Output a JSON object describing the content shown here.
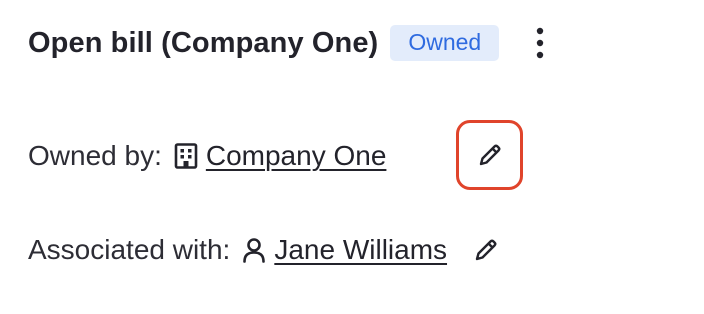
{
  "header": {
    "title": "Open bill (Company One)",
    "status_badge": "Owned"
  },
  "owned_by": {
    "label": "Owned by:",
    "icon": "building-icon",
    "value": "Company One",
    "edit_icon": "pencil-icon",
    "highlight_color": "#e0442b"
  },
  "associated_with": {
    "label": "Associated with:",
    "icon": "user-icon",
    "value": "Jane Williams",
    "edit_icon": "pencil-icon"
  },
  "colors": {
    "badge_bg": "#e3ecfb",
    "badge_text": "#2f6be0",
    "text": "#23232b"
  }
}
